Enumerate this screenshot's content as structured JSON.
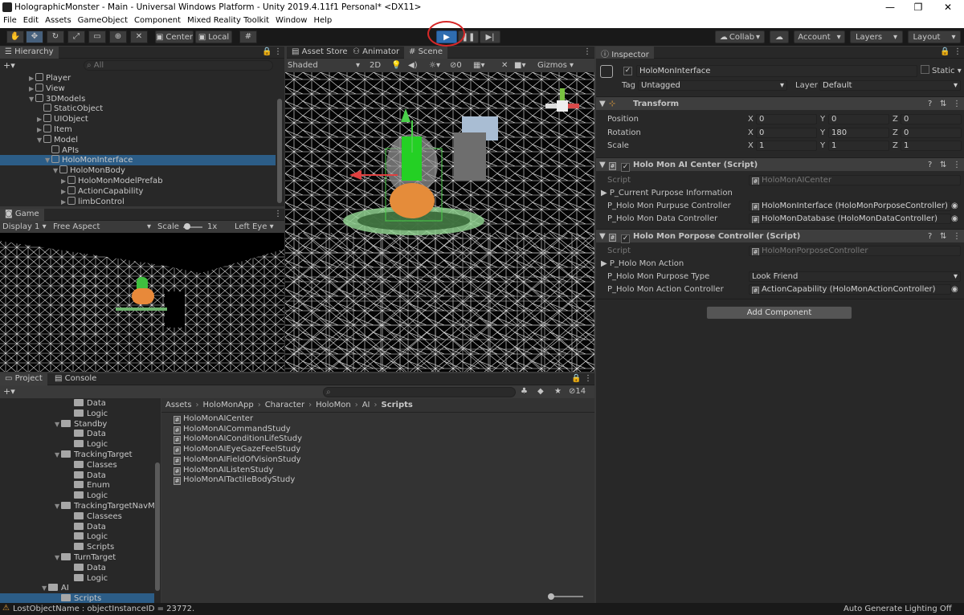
{
  "window": {
    "title": "HolographicMonster - Main - Universal Windows Platform - Unity 2019.4.11f1 Personal* <DX11>",
    "minimize": "—",
    "restore": "❐",
    "close": "✕"
  },
  "menu": [
    "File",
    "Edit",
    "Assets",
    "GameObject",
    "Component",
    "Mixed Reality Toolkit",
    "Window",
    "Help"
  ],
  "toolbar": {
    "center": "Center",
    "local": "Local",
    "collab": "Collab",
    "account": "Account",
    "layers": "Layers",
    "layout": "Layout"
  },
  "hierarchy": {
    "tab": "Hierarchy",
    "search_placeholder": "All",
    "items": [
      {
        "label": "Player",
        "indent": 2,
        "arrow": "▶"
      },
      {
        "label": "View",
        "indent": 2,
        "arrow": "▶"
      },
      {
        "label": "3DModels",
        "indent": 2,
        "arrow": "▼"
      },
      {
        "label": "StaticObject",
        "indent": 3,
        "arrow": ""
      },
      {
        "label": "UIObject",
        "indent": 3,
        "arrow": "▶"
      },
      {
        "label": "Item",
        "indent": 3,
        "arrow": "▶"
      },
      {
        "label": "Model",
        "indent": 3,
        "arrow": "▼"
      },
      {
        "label": "APIs",
        "indent": 4,
        "arrow": ""
      },
      {
        "label": "HoloMonInterface",
        "indent": 4,
        "arrow": "▼",
        "selected": true
      },
      {
        "label": "HoloMonBody",
        "indent": 5,
        "arrow": "▼"
      },
      {
        "label": "HoloMonModelPrefab",
        "indent": 6,
        "arrow": "▶"
      },
      {
        "label": "ActionCapability",
        "indent": 6,
        "arrow": "▶"
      },
      {
        "label": "limbControl",
        "indent": 6,
        "arrow": "▶"
      }
    ]
  },
  "game": {
    "tab": "Game",
    "display": "Display 1",
    "aspect": "Free Aspect",
    "scale_label": "Scale",
    "scale_value": "1x",
    "eye": "Left Eye"
  },
  "scene": {
    "tabs": [
      "Asset Store",
      "Animator",
      "Scene"
    ],
    "shading": "Shaded",
    "mode2d": "2D",
    "hidden_count": "0",
    "gizmos": "Gizmos"
  },
  "project": {
    "tabs": [
      "Project",
      "Console"
    ],
    "count": "14",
    "breadcrumb": [
      "Assets",
      "HoloMonApp",
      "Character",
      "HoloMon",
      "AI",
      "Scripts"
    ],
    "tree": [
      {
        "label": "Data",
        "indent": 4,
        "arrow": ""
      },
      {
        "label": "Logic",
        "indent": 4,
        "arrow": ""
      },
      {
        "label": "Standby",
        "indent": 3,
        "arrow": "▼"
      },
      {
        "label": "Data",
        "indent": 4,
        "arrow": ""
      },
      {
        "label": "Logic",
        "indent": 4,
        "arrow": ""
      },
      {
        "label": "TrackingTarget",
        "indent": 3,
        "arrow": "▼"
      },
      {
        "label": "Classes",
        "indent": 4,
        "arrow": ""
      },
      {
        "label": "Data",
        "indent": 4,
        "arrow": ""
      },
      {
        "label": "Enum",
        "indent": 4,
        "arrow": ""
      },
      {
        "label": "Logic",
        "indent": 4,
        "arrow": ""
      },
      {
        "label": "TrackingTargetNavM",
        "indent": 3,
        "arrow": "▼"
      },
      {
        "label": "Classees",
        "indent": 4,
        "arrow": ""
      },
      {
        "label": "Data",
        "indent": 4,
        "arrow": ""
      },
      {
        "label": "Logic",
        "indent": 4,
        "arrow": ""
      },
      {
        "label": "Scripts",
        "indent": 4,
        "arrow": ""
      },
      {
        "label": "TurnTarget",
        "indent": 3,
        "arrow": "▼"
      },
      {
        "label": "Data",
        "indent": 4,
        "arrow": ""
      },
      {
        "label": "Logic",
        "indent": 4,
        "arrow": ""
      },
      {
        "label": "AI",
        "indent": 2,
        "arrow": "▼"
      },
      {
        "label": "Scripts",
        "indent": 3,
        "arrow": "",
        "selected": true
      }
    ],
    "files": [
      "HoloMonAICenter",
      "HoloMonAICommandStudy",
      "HoloMonAIConditionLifeStudy",
      "HoloMonAIEyeGazeFeelStudy",
      "HoloMonAIFieldOfVisionStudy",
      "HoloMonAIListenStudy",
      "HoloMonAITactileBodyStudy"
    ]
  },
  "inspector": {
    "tab": "Inspector",
    "object_name": "HoloMonInterface",
    "static": "Static",
    "tag_label": "Tag",
    "tag": "Untagged",
    "layer_label": "Layer",
    "layer": "Default",
    "transform": {
      "title": "Transform",
      "position_label": "Position",
      "rotation_label": "Rotation",
      "scale_label": "Scale",
      "position": [
        "0",
        "0",
        "0"
      ],
      "rotation": [
        "0",
        "180",
        "0"
      ],
      "scale": [
        "1",
        "1",
        "1"
      ]
    },
    "ai_center": {
      "title": "Holo Mon AI Center (Script)",
      "script_label": "Script",
      "script": "HoloMonAICenter",
      "purpose_info": "P_Current Purpose Information",
      "purpose_ctrl_label": "P_Holo Mon Purpuse Controller",
      "purpose_ctrl": "HoloMonInterface (HoloMonPorposeController)",
      "data_ctrl_label": "P_Holo Mon Data Controller",
      "data_ctrl": "HoloMonDatabase (HoloMonDataController)"
    },
    "purpose_ctrl": {
      "title": "Holo Mon Porpose Controller (Script)",
      "script_label": "Script",
      "script": "HoloMonPorposeController",
      "action": "P_Holo Mon Action",
      "purpose_type_label": "P_Holo Mon Purpose Type",
      "purpose_type": "Look Friend",
      "action_ctrl_label": "P_Holo Mon Action Controller",
      "action_ctrl": "ActionCapability (HoloMonActionController)"
    },
    "add_component": "Add Component"
  },
  "status": {
    "message": "LostObjectName : objectInstanceID = 23772.",
    "lighting": "Auto Generate Lighting Off"
  },
  "colors": {
    "play_active": "#2f6db0",
    "selection": "#2c5d87",
    "annotation_circle": "#d62828"
  }
}
